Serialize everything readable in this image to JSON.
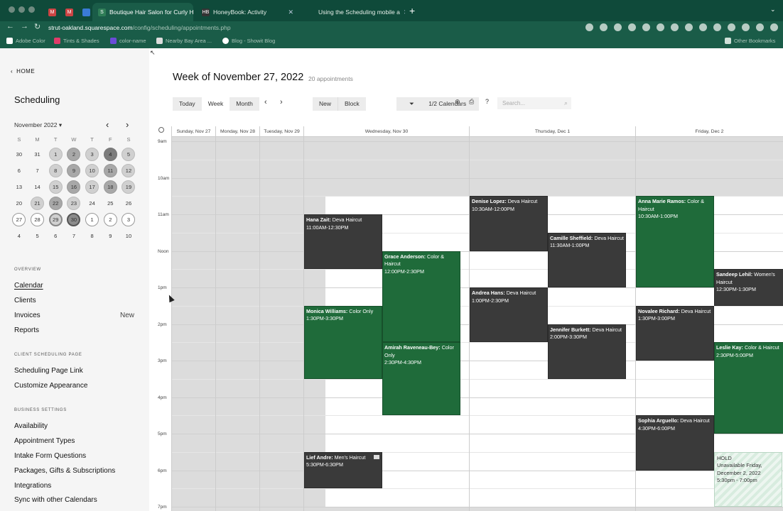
{
  "browser": {
    "tabs": [
      {
        "label": "Boutique Hair Salon for Curly H",
        "active": true
      },
      {
        "label": "HoneyBook: Activity",
        "active": false
      },
      {
        "label": "Using the Scheduling mobile a",
        "active": false
      }
    ],
    "url_host": "strut-oakland.squarespace.com",
    "url_path": "/config/scheduling/appointments.php",
    "bookmarks": [
      "Adobe Color",
      "Tints & Shades",
      "color-name",
      "Nearby Bay Area ...",
      "Blog - Showit Blog"
    ],
    "other_bookmarks": "Other Bookmarks"
  },
  "sidebar": {
    "home_label": "HOME",
    "title": "Scheduling",
    "month_label": "November 2022",
    "weekdays": [
      "S",
      "M",
      "T",
      "W",
      "T",
      "F",
      "S"
    ],
    "days": [
      {
        "n": "30",
        "s": ""
      },
      {
        "n": "31",
        "s": ""
      },
      {
        "n": "1",
        "s": "l"
      },
      {
        "n": "2",
        "s": "m"
      },
      {
        "n": "3",
        "s": "l"
      },
      {
        "n": "4",
        "s": "d"
      },
      {
        "n": "5",
        "s": "l"
      },
      {
        "n": "6",
        "s": ""
      },
      {
        "n": "7",
        "s": ""
      },
      {
        "n": "8",
        "s": "l"
      },
      {
        "n": "9",
        "s": "m"
      },
      {
        "n": "10",
        "s": "l"
      },
      {
        "n": "11",
        "s": "m"
      },
      {
        "n": "12",
        "s": "l"
      },
      {
        "n": "13",
        "s": ""
      },
      {
        "n": "14",
        "s": ""
      },
      {
        "n": "15",
        "s": "l"
      },
      {
        "n": "16",
        "s": "m"
      },
      {
        "n": "17",
        "s": "l"
      },
      {
        "n": "18",
        "s": "m"
      },
      {
        "n": "19",
        "s": "l"
      },
      {
        "n": "20",
        "s": ""
      },
      {
        "n": "21",
        "s": "l"
      },
      {
        "n": "22",
        "s": "m"
      },
      {
        "n": "23",
        "s": "l"
      },
      {
        "n": "24",
        "s": ""
      },
      {
        "n": "25",
        "s": ""
      },
      {
        "n": "26",
        "s": ""
      },
      {
        "n": "27",
        "s": "o"
      },
      {
        "n": "28",
        "s": "o"
      },
      {
        "n": "29",
        "s": "ol"
      },
      {
        "n": "30",
        "s": "od"
      },
      {
        "n": "1",
        "s": "o"
      },
      {
        "n": "2",
        "s": "o"
      },
      {
        "n": "3",
        "s": "o"
      },
      {
        "n": "4",
        "s": ""
      },
      {
        "n": "5",
        "s": ""
      },
      {
        "n": "6",
        "s": ""
      },
      {
        "n": "7",
        "s": ""
      },
      {
        "n": "8",
        "s": ""
      },
      {
        "n": "9",
        "s": ""
      },
      {
        "n": "10",
        "s": ""
      }
    ],
    "overview_heading": "OVERVIEW",
    "overview_links": [
      "Calendar",
      "Clients",
      "Invoices",
      "Reports"
    ],
    "invoices_badge": "New",
    "client_page_heading": "CLIENT SCHEDULING PAGE",
    "client_page_links": [
      "Scheduling Page Link",
      "Customize Appearance"
    ],
    "business_heading": "BUSINESS SETTINGS",
    "business_links": [
      "Availability",
      "Appointment Types",
      "Intake Form Questions",
      "Packages, Gifts & Subscriptions",
      "Integrations",
      "Sync with other Calendars"
    ]
  },
  "main": {
    "week_title": "Week of November 27, 2022",
    "appointment_count": "20 appointments",
    "view_buttons": [
      "Today",
      "Week",
      "Month"
    ],
    "selected_view": "Week",
    "action_buttons": [
      "New",
      "Block"
    ],
    "calendars_filter": "1/2 Calendars",
    "search_placeholder": "Search...",
    "days": [
      "Sunday, Nov 27",
      "Monday, Nov 28",
      "Tuesday, Nov 29",
      "Wednesday, Nov 30",
      "Thursday, Dec 1",
      "Friday, Dec 2"
    ],
    "times": [
      "9am",
      "10am",
      "11am",
      "Noon",
      "1pm",
      "2pm",
      "3pm",
      "4pm",
      "5pm",
      "6pm",
      "7pm"
    ],
    "appointments": [
      {
        "day": 3,
        "sub": 0,
        "start": 11.0,
        "end": 12.5,
        "color": "dark",
        "name": "Hana Zait:",
        "type": "Deva Haircut",
        "time": "11:00AM-12:30PM"
      },
      {
        "day": 3,
        "sub": 1,
        "start": 12.0,
        "end": 14.5,
        "color": "green",
        "name": "Grace Anderson:",
        "type": "Color & Haircut",
        "time": "12:00PM-2:30PM"
      },
      {
        "day": 3,
        "sub": 0,
        "start": 13.5,
        "end": 15.5,
        "color": "green",
        "name": "Monica Williams:",
        "type": "Color Only",
        "time": "1:30PM-3:30PM"
      },
      {
        "day": 3,
        "sub": 1,
        "start": 14.5,
        "end": 16.5,
        "color": "green",
        "name": "Amirah Raveneau-Bey:",
        "type": "Color Only",
        "time": "2:30PM-4:30PM"
      },
      {
        "day": 3,
        "sub": 0,
        "start": 17.5,
        "end": 18.5,
        "color": "dark",
        "name": "Lief Andre:",
        "type": "Men's Haircut",
        "time": "5:30PM-6:30PM",
        "mail": true
      },
      {
        "day": 4,
        "sub": 0,
        "start": 10.5,
        "end": 12.0,
        "color": "dark",
        "name": "Denise Lopez:",
        "type": "Deva Haircut",
        "time": "10:30AM-12:00PM"
      },
      {
        "day": 4,
        "sub": 1,
        "start": 11.5,
        "end": 13.0,
        "color": "dark",
        "name": "Camille Sheffield:",
        "type": "Deva Haircut",
        "time": "11:30AM-1:00PM"
      },
      {
        "day": 4,
        "sub": 0,
        "start": 13.0,
        "end": 14.5,
        "color": "dark",
        "name": "Andrea Hans:",
        "type": "Deva Haircut",
        "time": "1:00PM-2:30PM"
      },
      {
        "day": 4,
        "sub": 1,
        "start": 14.0,
        "end": 15.5,
        "color": "dark",
        "name": "Jennifer Burkett:",
        "type": "Deva Haircut",
        "time": "2:00PM-3:30PM"
      },
      {
        "day": 5,
        "sub": 0,
        "start": 10.5,
        "end": 13.0,
        "color": "green",
        "name": "Anna Marie Ramos:",
        "type": "Color & Haircut",
        "time": "10:30AM-1:00PM"
      },
      {
        "day": 5,
        "sub": 1,
        "start": 12.5,
        "end": 13.5,
        "color": "dark",
        "name": "Sandeep Lehil:",
        "type": "Women's Haircut",
        "time": "12:30PM-1:30PM"
      },
      {
        "day": 5,
        "sub": 0,
        "start": 13.5,
        "end": 15.0,
        "color": "dark",
        "name": "Novalee Richard:",
        "type": "Deva Haircut",
        "time": "1:30PM-3:00PM"
      },
      {
        "day": 5,
        "sub": 1,
        "start": 14.5,
        "end": 17.0,
        "color": "green",
        "name": "Leslie Kay:",
        "type": "Color & Haircut",
        "time": "2:30PM-5:00PM"
      },
      {
        "day": 5,
        "sub": 0,
        "start": 16.5,
        "end": 18.0,
        "color": "dark",
        "name": "Sophia Arguello:",
        "type": "Deva Haircut",
        "time": "4:30PM-6:00PM"
      }
    ],
    "hold": {
      "day": 5,
      "start": 17.5,
      "end": 19.0,
      "title": "HOLD",
      "text": "Unavailable Friday, December 2, 2022 5:30pm - 7:00pm"
    },
    "colors": {
      "dark": "#3a3a3a",
      "green": "#1f6b3a",
      "unavailable": "#dcdcdc"
    }
  }
}
